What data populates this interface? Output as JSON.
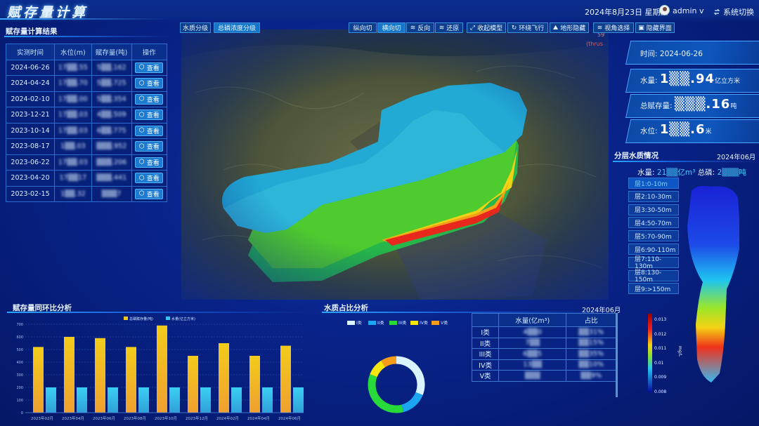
{
  "header": {
    "title": "赋存量计算",
    "date": "2024年8月23日",
    "weekday": "星期五",
    "user": "admin v",
    "system_switch": "系统切换"
  },
  "left_panel": {
    "title": "赋存量计算结果",
    "columns": [
      "实测时间",
      "水位(m)",
      "赋存量(吨)",
      "操作"
    ],
    "view_label": "查看",
    "rows": [
      {
        "date": "2024-06-26",
        "level": "17▒▒.55",
        "amount": "5▒▒.162"
      },
      {
        "date": "2024-04-24",
        "level": "17▒▒.70",
        "amount": "5▒▒.725"
      },
      {
        "date": "2024-02-10",
        "level": "17▒▒.00",
        "amount": "5▒▒.354"
      },
      {
        "date": "2023-12-21",
        "level": "17▒▒.03",
        "amount": "4▒▒.509"
      },
      {
        "date": "2023-10-14",
        "level": "17▒▒.03",
        "amount": "6▒▒.775"
      },
      {
        "date": "2023-08-17",
        "level": "1▒▒.03",
        "amount": "▒▒▒.952"
      },
      {
        "date": "2023-06-22",
        "level": "17▒▒.03",
        "amount": "▒▒▒.206"
      },
      {
        "date": "2023-04-20",
        "level": "17▒▒17",
        "amount": "▒▒▒.441"
      },
      {
        "date": "2023-02-15",
        "level": "1▒▒.32",
        "amount": "▒▒▒7"
      }
    ]
  },
  "toolbar": {
    "left": [
      "水质分级",
      "总磷浓度分级"
    ],
    "right": [
      "纵向切",
      "横向切",
      "反向",
      "还原",
      "收起模型",
      "环绕飞行",
      "地形隐藏",
      "视角选择",
      "隐藏界面"
    ],
    "overlay_text": "59",
    "overlay_text2": "(thrus"
  },
  "right_panel": {
    "time_label": "时间:",
    "time_value": "2024-06-26",
    "water_label": "水量:",
    "water_value": "1▒▒.94",
    "water_unit": "亿立方米",
    "storage_label": "总赋存量:",
    "storage_value": "▒▒▒.16",
    "storage_unit": "吨",
    "level_label": "水位:",
    "level_value": "1▒▒.6",
    "level_unit": "米",
    "layer_title": "分层水质情况",
    "layer_date": "2024年06月",
    "layer_water_label": "水量:",
    "layer_water_value": "21▒▒亿m³",
    "layer_p_label": "总磷:",
    "layer_p_value": "2▒▒▒吨",
    "layers": [
      "层1:0-10m",
      "层2:10-30m",
      "层3:30-50m",
      "层4:50-70m",
      "层5:70-90m",
      "层6:90-110m",
      "层7:110-130m",
      "层8:130-150m",
      "层9:>150m"
    ],
    "colorbar_ticks": [
      "0.013",
      "0.012",
      "0.011",
      "0.01",
      "0.009",
      "0.008"
    ],
    "colorbar_unit": "mg/L"
  },
  "bar_panel": {
    "title": "赋存量同环比分析"
  },
  "donut_panel": {
    "title": "水质占比分析",
    "date": "2024年06月",
    "legend": [
      "I类",
      "II类",
      "III类",
      "IV类",
      "V类"
    ],
    "table_headers": [
      "",
      "水量(亿m³)",
      "占比"
    ],
    "table_rows": [
      {
        "cls": "I类",
        "water": "4▒▒0",
        "ratio": "▒▒31%"
      },
      {
        "cls": "II类",
        "water": "7▒▒",
        "ratio": "▒▒15%"
      },
      {
        "cls": "III类",
        "water": "6▒▒5",
        "ratio": "▒▒35%"
      },
      {
        "cls": "IV类",
        "water": "13▒▒",
        "ratio": "▒▒10%"
      },
      {
        "cls": "V类",
        "water": "▒▒▒",
        "ratio": "▒▒9%"
      }
    ]
  },
  "chart_data": [
    {
      "type": "bar",
      "title": "赋存量同环比分析",
      "categories": [
        "2023年02月",
        "2023年04月",
        "2023年06月",
        "2023年08月",
        "2023年10月",
        "2023年12月",
        "2024年02月",
        "2024年04月",
        "2024年06月"
      ],
      "series": [
        {
          "name": "总磷赋存量(吨)",
          "color": "#f2c91a",
          "values": [
            520,
            600,
            590,
            520,
            690,
            450,
            550,
            450,
            530
          ]
        },
        {
          "name": "水量(亿立方米)",
          "color": "#35c6f0",
          "values": [
            200,
            200,
            200,
            200,
            200,
            200,
            200,
            200,
            200
          ]
        }
      ],
      "ylim": [
        0,
        700
      ],
      "yticks": [
        "0",
        "100",
        "200",
        "300",
        "400",
        "500",
        "600",
        "700"
      ],
      "grid": true,
      "legend": "top"
    },
    {
      "type": "pie",
      "title": "水质占比分析",
      "categories": [
        "I类",
        "II类",
        "III类",
        "IV类",
        "V类"
      ],
      "values": [
        31,
        15,
        35,
        10,
        9
      ],
      "colors": [
        "#d9f3ff",
        "#1aa6f0",
        "#28d93a",
        "#f5e60f",
        "#f59c1a"
      ]
    }
  ],
  "colors": {
    "accent": "#2aa4ff",
    "panel": "#072079",
    "button": "#1c7bd0"
  }
}
